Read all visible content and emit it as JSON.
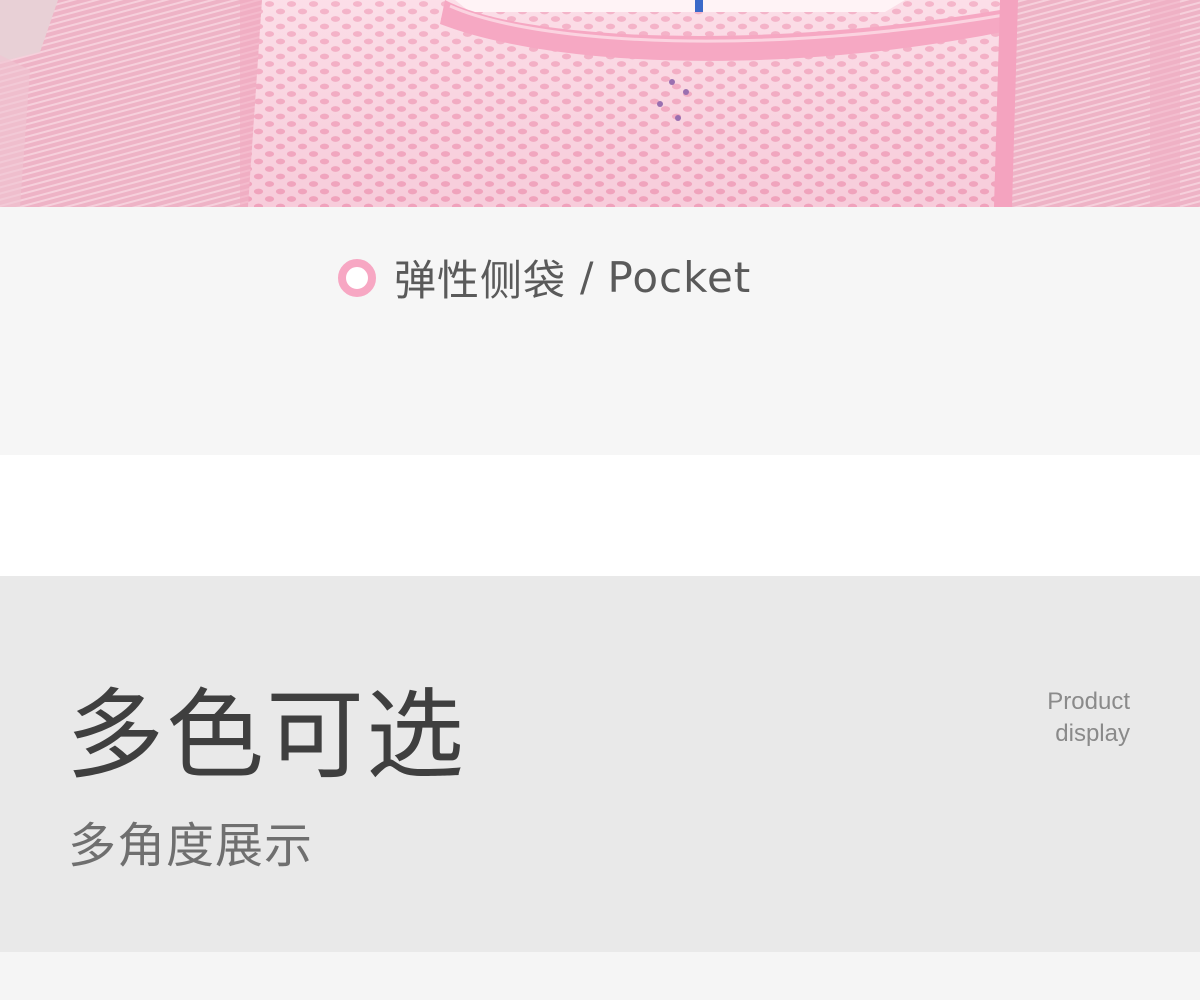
{
  "photo": {
    "icon": "backpack-mesh-pocket-photo",
    "colors": {
      "fabric": "#f0b7ca",
      "mesh": "#f7c9d8",
      "trim": "#f39ab9"
    }
  },
  "caption": {
    "icon": "ring-bullet-icon",
    "accent": "#f7a7c3",
    "title_cn": "弹性侧袋",
    "separator": "/",
    "title_en": "Pocket"
  },
  "section": {
    "title": "多色可选",
    "subtitle": "多角度展示",
    "en_line1": "Product",
    "en_line2": "display"
  }
}
